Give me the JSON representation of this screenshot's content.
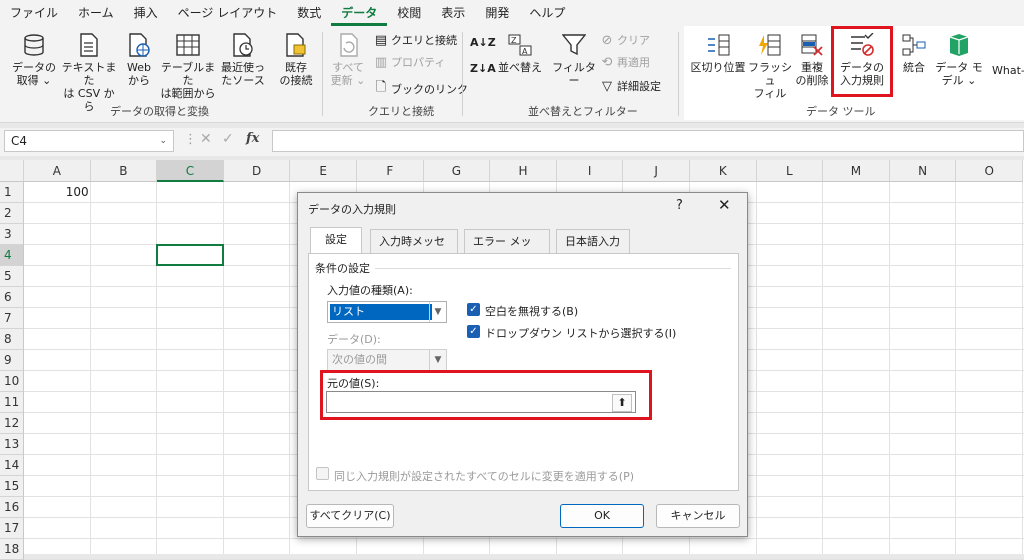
{
  "menubar": [
    "ファイル",
    "ホーム",
    "挿入",
    "ページ レイアウト",
    "数式",
    "データ",
    "校閲",
    "表示",
    "開発",
    "ヘルプ"
  ],
  "menubar_active_index": 5,
  "ribbon": {
    "get_data": {
      "l1": "データの",
      "l2": "取得 ⌄"
    },
    "from_text": {
      "l1": "テキストまた",
      "l2": "は CSV から"
    },
    "from_web": {
      "l1": "Web",
      "l2": "から"
    },
    "from_table": {
      "l1": "テーブルまた",
      "l2": "は範囲から"
    },
    "recent": {
      "l1": "最近使っ",
      "l2": "たソース"
    },
    "existing": {
      "l1": "既存",
      "l2": "の接続"
    },
    "group1": "データの取得と変換",
    "refresh_all": {
      "l1": "すべて",
      "l2": "更新 ⌄"
    },
    "queries": "クエリと接続",
    "properties": "プロパティ",
    "edit_links": "ブックのリンク",
    "group2": "クエリと接続",
    "sort": "並べ替え",
    "filter": "フィルター",
    "clear": "クリア",
    "reapply": "再適用",
    "advanced": "詳細設定",
    "group3": "並べ替えとフィルター",
    "text_to_columns": "区切り位置",
    "flash_fill": {
      "l1": "フラッシュ",
      "l2": "フィル"
    },
    "remove_dup": {
      "l1": "重複",
      "l2": "の削除"
    },
    "validation": {
      "l1": "データの",
      "l2": "入力規則 ⌄"
    },
    "consolidate": "統合",
    "data_model": {
      "l1": "データ モ",
      "l2": "デル ⌄"
    },
    "whatif": "What-If",
    "group4": "データ ツール"
  },
  "formula": {
    "name_box": "C4",
    "fx": "fx"
  },
  "columns": [
    "A",
    "B",
    "C",
    "D",
    "E",
    "F",
    "G",
    "H",
    "I",
    "J",
    "K",
    "L",
    "M",
    "N",
    "O"
  ],
  "rows": [
    "1",
    "2",
    "3",
    "4",
    "5",
    "6",
    "7",
    "8",
    "9",
    "10",
    "11",
    "12",
    "13",
    "14",
    "15",
    "16",
    "17",
    "18"
  ],
  "cells": {
    "A1": "100"
  },
  "dialog": {
    "title": "データの入力規則",
    "help": "?",
    "close": "✕",
    "tabs": [
      "設定",
      "入力時メッセージ",
      "エラー メッセージ",
      "日本語入力"
    ],
    "section": "条件の設定",
    "allow_label": "入力値の種類(A):",
    "allow_value": "リスト",
    "ignore_blank": "空白を無視する(B)",
    "dropdown": "ドロップダウン リストから選択する(I)",
    "data_label": "データ(D):",
    "data_value": "次の値の間",
    "source_label": "元の値(S):",
    "source_value": "",
    "apply_all": "同じ入力規則が設定されたすべてのセルに変更を適用する(P)",
    "clear_all": "すべてクリア(C)",
    "ok": "OK",
    "cancel": "キャンセル"
  }
}
